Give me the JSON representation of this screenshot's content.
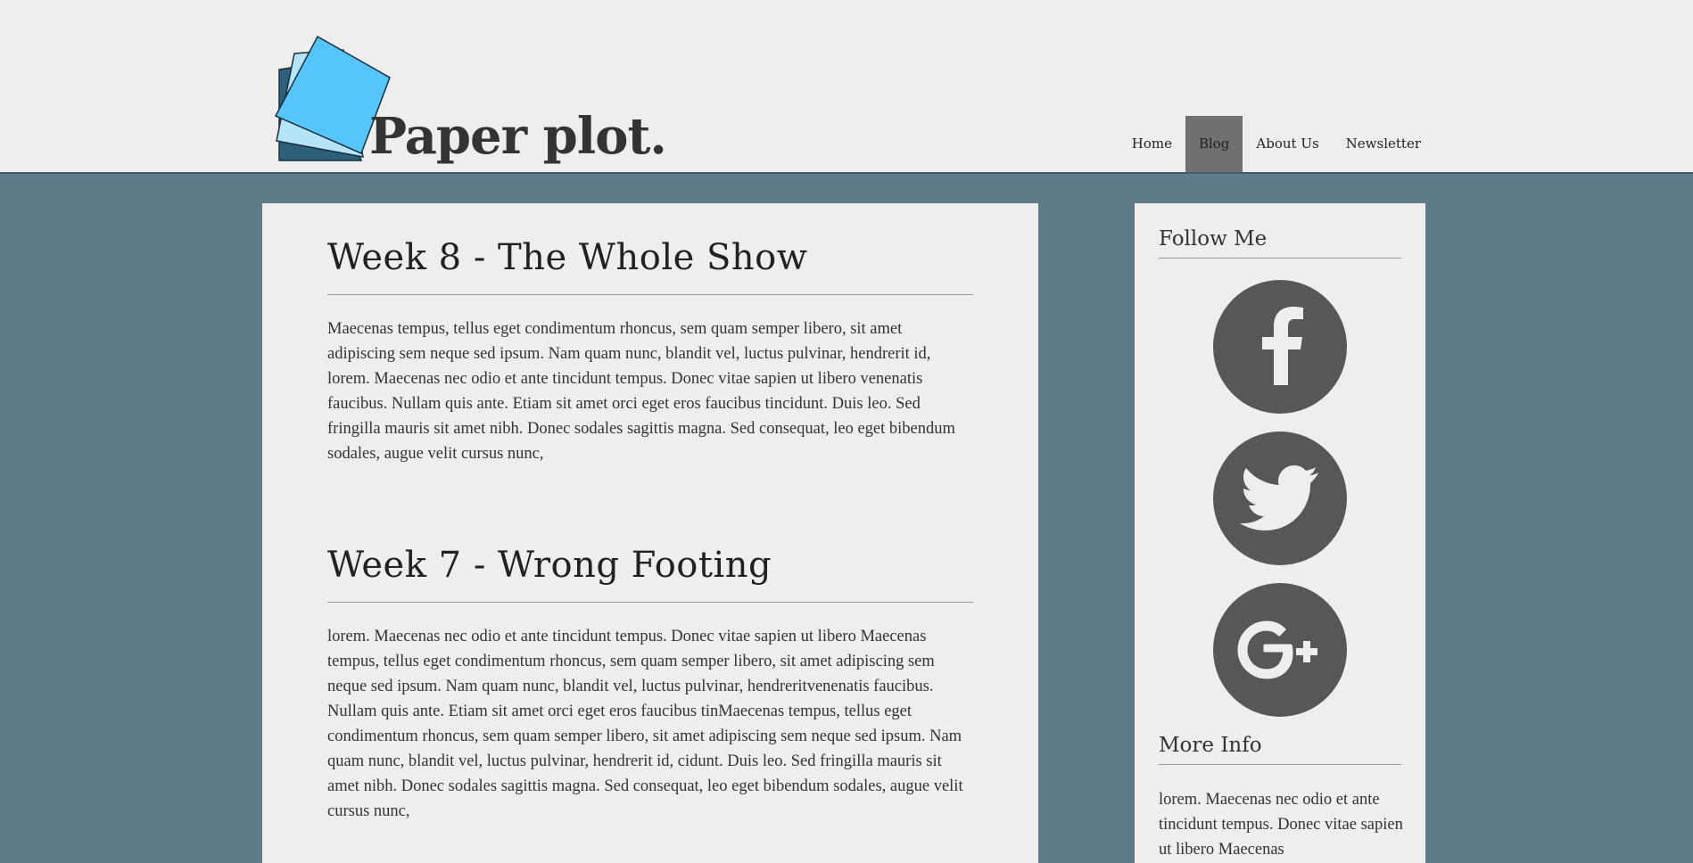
{
  "site": {
    "title": "Paper plot."
  },
  "nav": {
    "items": [
      {
        "label": "Home"
      },
      {
        "label": "Blog",
        "active": true
      },
      {
        "label": "About Us"
      },
      {
        "label": "Newsletter"
      }
    ]
  },
  "posts": [
    {
      "title": "Week 8 - The Whole Show",
      "body": "Maecenas tempus, tellus eget condimentum rhoncus, sem quam semper libero, sit amet adipiscing sem neque sed ipsum. Nam quam nunc, blandit vel, luctus pulvinar, hendrerit id, lorem. Maecenas nec odio et ante tincidunt tempus. Donec vitae sapien ut libero venenatis faucibus. Nullam quis ante. Etiam sit amet orci eget eros faucibus tincidunt. Duis leo. Sed fringilla mauris sit amet nibh. Donec sodales sagittis magna. Sed consequat, leo eget bibendum sodales, augue velit cursus nunc,"
    },
    {
      "title": "Week 7 - Wrong Footing",
      "body": "lorem. Maecenas nec odio et ante tincidunt tempus. Donec vitae sapien ut libero Maecenas tempus, tellus eget condimentum rhoncus, sem quam semper libero, sit amet adipiscing sem neque sed ipsum. Nam quam nunc, blandit vel, luctus pulvinar, hendreritvenenatis faucibus. Nullam quis ante. Etiam sit amet orci eget eros faucibus tinMaecenas tempus, tellus eget condimentum rhoncus, sem quam semper libero, sit amet adipiscing sem neque sed ipsum. Nam quam nunc, blandit vel, luctus pulvinar, hendrerit id, cidunt. Duis leo. Sed fringilla mauris sit amet nibh. Donec sodales sagittis magna. Sed consequat, leo eget bibendum sodales, augue velit cursus nunc,"
    }
  ],
  "sidebar": {
    "follow_title": "Follow Me",
    "social": [
      {
        "icon": "facebook-icon"
      },
      {
        "icon": "twitter-icon"
      },
      {
        "icon": "google-plus-icon"
      }
    ],
    "more_info_title": "More Info",
    "more_info_text": "lorem. Maecenas nec odio et ante tincidunt tempus. Donec vitae sapien ut libero Maecenas"
  },
  "colors": {
    "page_background": "#5f7b8a",
    "header_background": "#eeeeee",
    "nav_active": "#707070",
    "social_circle": "#575757",
    "logo_front": "#55c5fb",
    "logo_middle": "#b5e3f7",
    "logo_back": "#2e607a"
  }
}
